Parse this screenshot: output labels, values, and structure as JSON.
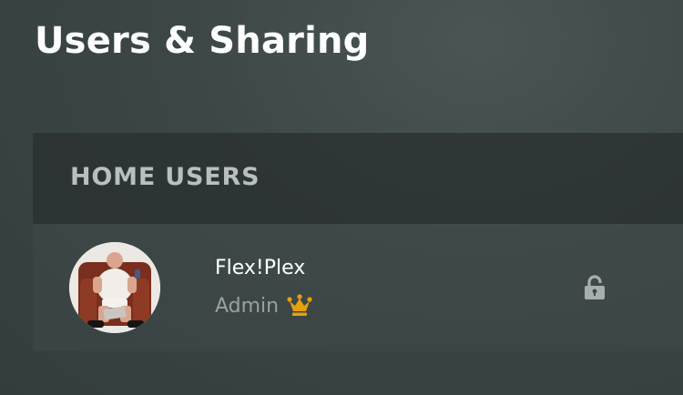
{
  "page": {
    "title": "Users & Sharing"
  },
  "home_users": {
    "heading": "HOME USERS",
    "users": [
      {
        "name": "Flex!Plex",
        "role": "Admin",
        "role_icon": "crown-icon",
        "lock_icon": "unlocked-lock-icon"
      }
    ]
  },
  "colors": {
    "crown": "#e5a00d",
    "role_text": "#9aa0a0",
    "lock": "#a8adad"
  }
}
